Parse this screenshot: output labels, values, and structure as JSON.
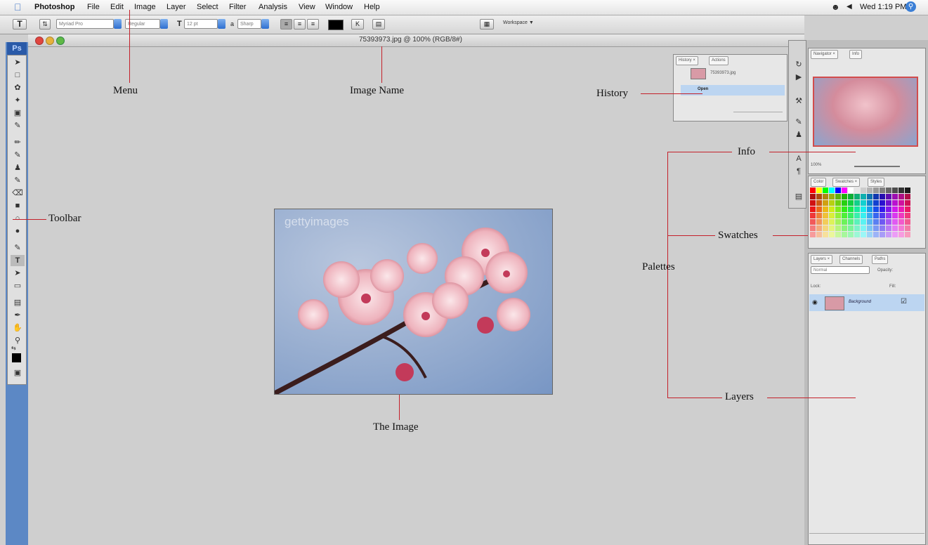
{
  "menubar": {
    "apple": "",
    "items": [
      "Photoshop",
      "File",
      "Edit",
      "Image",
      "Layer",
      "Select",
      "Filter",
      "Analysis",
      "View",
      "Window",
      "Help"
    ],
    "clock": "Wed 1:19 PM"
  },
  "options": {
    "tool_glyph": "T",
    "font_family": "Myriad Pro",
    "font_style": "Regular",
    "font_size": "12 pt",
    "antialias": "Sharp",
    "workspace": "Workspace ▼"
  },
  "document": {
    "title": "75393973.jpg @ 100% (RGB/8#)",
    "watermark": "gettyimages"
  },
  "toolbar": {
    "logo": "Ps"
  },
  "history_panel": {
    "tabs": [
      "History ×",
      "Actions"
    ],
    "snapshot": "75393973.jpg",
    "step": "Open"
  },
  "navigator_panel": {
    "tabs": [
      "Navigator ×",
      "Info"
    ],
    "zoom": "100%"
  },
  "swatches_panel": {
    "tabs": [
      "Color",
      "Swatches ×",
      "Styles"
    ]
  },
  "layers_panel": {
    "tabs": [
      "Layers ×",
      "Channels",
      "Paths"
    ],
    "blend": "Normal",
    "opacity_label": "Opacity:",
    "lock_label": "Lock:",
    "fill_label": "Fill:",
    "layer_name": "Background"
  },
  "annotations": {
    "menu": "Menu",
    "image_name": "Image Name",
    "history": "History",
    "info": "Info",
    "toolbar": "Toolbar",
    "swatches": "Swatches",
    "palettes": "Palettes",
    "layers": "Layers",
    "the_image": "The Image"
  },
  "colors": {
    "annotation_line": "#c4202a",
    "toolbar_blue": "#5c88c5"
  }
}
